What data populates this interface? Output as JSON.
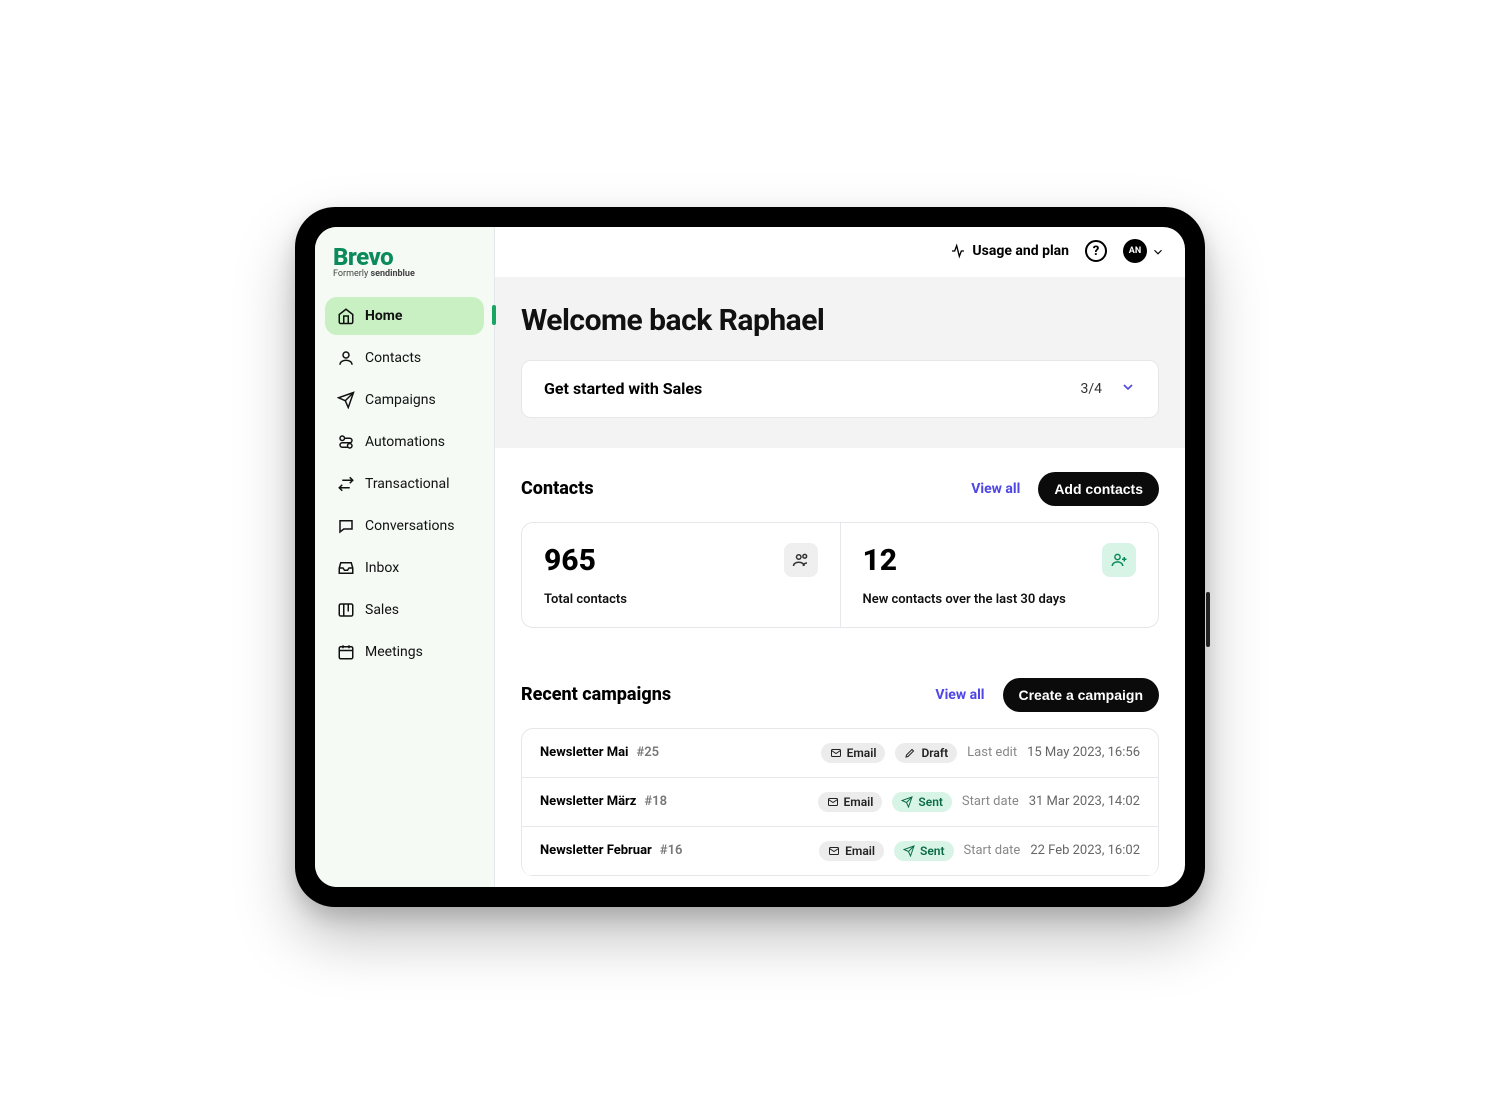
{
  "brand": {
    "name": "Brevo",
    "tagline_prefix": "Formerly ",
    "tagline_bold": "sendinblue"
  },
  "sidebar": {
    "items": [
      {
        "label": "Home"
      },
      {
        "label": "Contacts"
      },
      {
        "label": "Campaigns"
      },
      {
        "label": "Automations"
      },
      {
        "label": "Transactional"
      },
      {
        "label": "Conversations"
      },
      {
        "label": "Inbox"
      },
      {
        "label": "Sales"
      },
      {
        "label": "Meetings"
      }
    ]
  },
  "topbar": {
    "usage_label": "Usage and plan",
    "help_glyph": "?",
    "avatar_initials": "AN"
  },
  "welcome": {
    "title": "Welcome back Raphael"
  },
  "get_started": {
    "title": "Get started with Sales",
    "progress": "3/4"
  },
  "contacts_section": {
    "title": "Contacts",
    "view_all": "View all",
    "add_button": "Add contacts",
    "cards": [
      {
        "value": "965",
        "label": "Total contacts"
      },
      {
        "value": "12",
        "label": "New contacts over the last 30 days"
      }
    ]
  },
  "campaigns_section": {
    "title": "Recent campaigns",
    "view_all": "View all",
    "create_button": "Create a campaign",
    "rows": [
      {
        "name": "Newsletter Mai",
        "id": "#25",
        "type": "Email",
        "status": "Draft",
        "status_style": "grey",
        "meta_label": "Last edit",
        "meta_value": "15 May 2023, 16:56"
      },
      {
        "name": "Newsletter März",
        "id": "#18",
        "type": "Email",
        "status": "Sent",
        "status_style": "green",
        "meta_label": "Start date",
        "meta_value": "31 Mar 2023, 14:02"
      },
      {
        "name": "Newsletter Februar",
        "id": "#16",
        "type": "Email",
        "status": "Sent",
        "status_style": "green",
        "meta_label": "Start date",
        "meta_value": "22 Feb 2023, 16:02"
      }
    ]
  }
}
